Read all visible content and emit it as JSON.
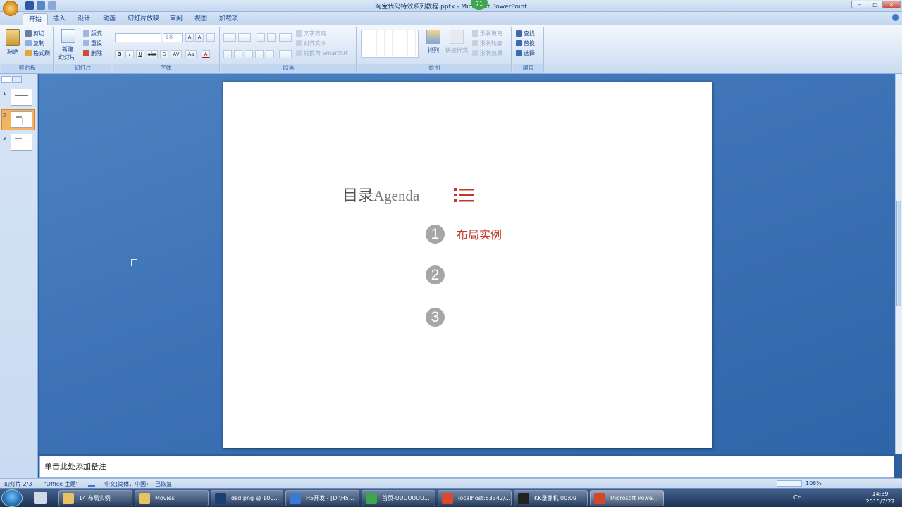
{
  "window": {
    "title": "淘宝代码特效系列教程.pptx - Microsoft PowerPoint",
    "notif_count": "71",
    "min": "–",
    "max": "□",
    "close": "×"
  },
  "tabs": [
    {
      "label": "开始"
    },
    {
      "label": "插入"
    },
    {
      "label": "设计"
    },
    {
      "label": "动画"
    },
    {
      "label": "幻灯片放映"
    },
    {
      "label": "审阅"
    },
    {
      "label": "视图"
    },
    {
      "label": "加载项"
    }
  ],
  "ribbon": {
    "clipboard": {
      "label": "剪贴板",
      "paste": "粘贴",
      "cut": "剪切",
      "copy": "复制",
      "format_painter": "格式刷"
    },
    "slides": {
      "label": "幻灯片",
      "new_slide": "新建",
      "new_slide2": "幻灯片",
      "layout": "版式",
      "reset": "重设",
      "delete": "删除"
    },
    "font": {
      "label": "字体",
      "size": "18",
      "grow": "A",
      "shrink": "A",
      "bold": "B",
      "italic": "I",
      "underline": "U",
      "strike": "abc",
      "shadow": "S",
      "spacing": "AV",
      "case": "Aa",
      "color": "A"
    },
    "paragraph": {
      "label": "段落",
      "text_direction": "文字方向",
      "align_text": "对齐文本",
      "smartart": "转换为 SmartArt"
    },
    "drawing": {
      "label": "绘图",
      "arrange": "排列",
      "quick_styles": "快速样式",
      "fill": "形状填充",
      "outline": "形状轮廓",
      "effects": "形状效果"
    },
    "editing": {
      "label": "编辑",
      "find": "查找",
      "replace": "替换",
      "select": "选择"
    }
  },
  "thumbnails": [
    {
      "num": "1"
    },
    {
      "num": "2"
    },
    {
      "num": "3"
    }
  ],
  "slide": {
    "title_cn": "目录",
    "title_en": "Agenda",
    "items": [
      {
        "num": "1",
        "text": "布局实例"
      },
      {
        "num": "2",
        "text": ""
      },
      {
        "num": "3",
        "text": ""
      }
    ]
  },
  "notes": {
    "placeholder": "单击此处添加备注"
  },
  "status": {
    "slide": "幻灯片 2/3",
    "theme": "\"Office 主题\"",
    "lang": "中文(简体，中国)",
    "recovered": "已恢复",
    "zoom": "108%"
  },
  "taskbar": {
    "items": [
      {
        "label": "14.布局实例",
        "color": "#e8c261"
      },
      {
        "label": "Movies",
        "color": "#e8c261"
      },
      {
        "label": "dsd.png @ 100...",
        "color": "#1d3e73"
      },
      {
        "label": "H5开发 - [D:\\H5...",
        "color": "#3a7ad5"
      },
      {
        "label": "首页-UUUUUUU...",
        "color": "#3ba64b"
      },
      {
        "label": "localhost:63342/...",
        "color": "#d9492c"
      },
      {
        "label": "KK录像机 00:09",
        "color": "#222222"
      },
      {
        "label": "Microsoft Powe...",
        "color": "#d24726"
      }
    ],
    "time": "14:39",
    "date": "2015/7/27",
    "ime": "CH"
  },
  "colors": {
    "accent_red": "#c0392b",
    "number_gray": "#a6a6a6"
  },
  "icons": [
    "paste-icon",
    "cut-icon",
    "copy-icon",
    "format-painter-icon",
    "new-slide-icon",
    "list-icon",
    "find-icon",
    "replace-icon",
    "select-icon",
    "windows-start-icon"
  ]
}
